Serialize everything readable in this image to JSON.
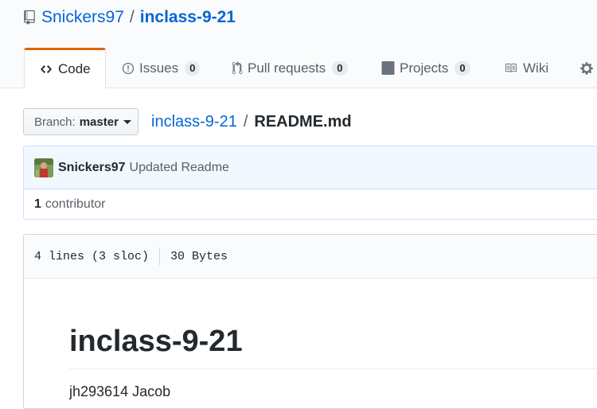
{
  "repo": {
    "owner": "Snickers97",
    "separator": "/",
    "name": "inclass-9-21"
  },
  "tabs": [
    {
      "label": "Code",
      "icon": "code-icon",
      "selected": true
    },
    {
      "label": "Issues",
      "icon": "issue-icon",
      "count": "0"
    },
    {
      "label": "Pull requests",
      "icon": "pull-request-icon",
      "count": "0"
    },
    {
      "label": "Projects",
      "icon": "project-icon",
      "count": "0"
    },
    {
      "label": "Wiki",
      "icon": "book-icon"
    }
  ],
  "branch": {
    "label": "Branch:",
    "value": "master"
  },
  "breadcrumb": {
    "repo": "inclass-9-21",
    "separator": "/",
    "file": "README.md"
  },
  "commit": {
    "author": "Snickers97",
    "message": "Updated Readme"
  },
  "contributors": {
    "count": "1",
    "label": "contributor"
  },
  "file_info": {
    "lines": "4 lines (3 sloc)",
    "size": "30 Bytes"
  },
  "readme": {
    "heading": "inclass-9-21",
    "text": "jh293614 Jacob"
  },
  "colors": {
    "link": "#0366d6",
    "selected_tab_accent": "#e36209",
    "commit_bg": "#f1f8ff"
  }
}
